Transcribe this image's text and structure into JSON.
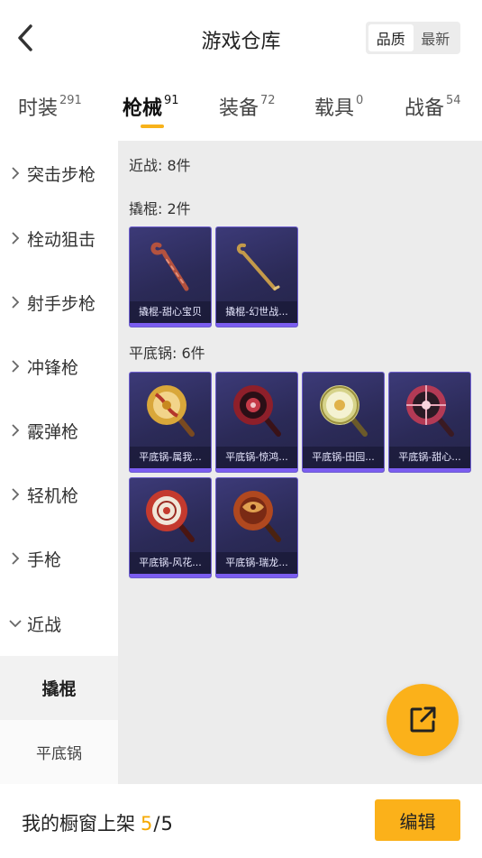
{
  "header": {
    "title": "游戏仓库",
    "back_icon": "chevron-left-icon",
    "sort_options": [
      "品质",
      "最新"
    ],
    "sort_selected": "品质"
  },
  "tabs": [
    {
      "label": "时装",
      "count": "291"
    },
    {
      "label": "枪械",
      "count": "91",
      "active": true
    },
    {
      "label": "装备",
      "count": "72"
    },
    {
      "label": "载具",
      "count": "0"
    },
    {
      "label": "战备",
      "count": "54"
    }
  ],
  "sidebar": {
    "items": [
      {
        "label": "突击步枪",
        "icon": "chevron-right-icon"
      },
      {
        "label": "栓动狙击",
        "icon": "chevron-right-icon"
      },
      {
        "label": "射手步枪",
        "icon": "chevron-right-icon"
      },
      {
        "label": "冲锋枪",
        "icon": "chevron-right-icon"
      },
      {
        "label": "霰弹枪",
        "icon": "chevron-right-icon"
      },
      {
        "label": "轻机枪",
        "icon": "chevron-right-icon"
      },
      {
        "label": "手枪",
        "icon": "chevron-right-icon"
      },
      {
        "label": "近战",
        "icon": "chevron-down-icon"
      }
    ],
    "sub_items": [
      {
        "label": "撬棍",
        "active": true
      },
      {
        "label": "平底锅"
      }
    ]
  },
  "content": {
    "melee_header": "近战: 8件",
    "crowbar_header": "撬棍: 2件",
    "crowbars": [
      {
        "name": "撬棍-甜心宝贝",
        "color": "#b4523f"
      },
      {
        "name": "撬棍-幻世战...",
        "color": "#c49a4a"
      }
    ],
    "pan_header": "平底锅: 6件",
    "pans": [
      {
        "name": "平底锅-属我...",
        "color": "#d9a73a"
      },
      {
        "name": "平底锅-惊鸿...",
        "color": "#8e1f2a"
      },
      {
        "name": "平底锅-田园...",
        "color": "#d6d38a"
      },
      {
        "name": "平底锅-甜心...",
        "color": "#b33a55"
      },
      {
        "name": "平底锅-风花...",
        "color": "#c43a2e"
      },
      {
        "name": "平底锅-瑞龙...",
        "color": "#b0481f"
      }
    ]
  },
  "fab": {
    "icon": "share-external-icon"
  },
  "bottom": {
    "shelf_label": "我的橱窗上架",
    "shelf_current": "5",
    "shelf_sep": "/",
    "shelf_total": "5",
    "edit_label": "编辑"
  }
}
